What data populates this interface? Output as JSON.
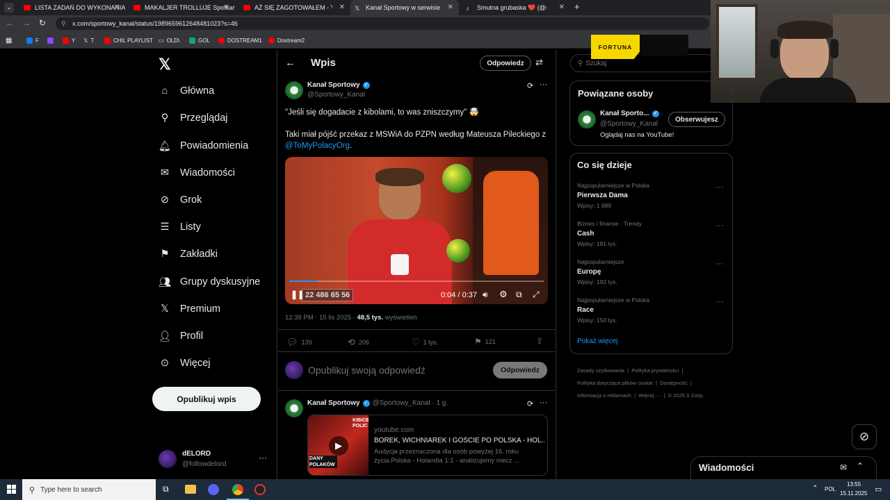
{
  "browser": {
    "tabs": [
      {
        "label": "LISTA ZADAŃ DO WYKONANIA"
      },
      {
        "label": "MAKALJER TROLLUJE Spotkani"
      },
      {
        "label": "AŻ SIĘ ZAGOTOWAŁEM - YouTu"
      },
      {
        "label": "Kanał Sportowy w serwisie X"
      },
      {
        "label": "Smutna grubaska ❤️ (@sm"
      }
    ],
    "url": "x.com/sportowy_kanal/status/1989659612648481023?s=46",
    "bookmarks": [
      "F",
      "Y",
      "T",
      "CHIL PLAYLIST",
      "OLD\\",
      "GOL",
      "DOSTREAM1",
      "Dostream2"
    ]
  },
  "sidebar": {
    "items": [
      {
        "label": "Główna"
      },
      {
        "label": "Przeglądaj"
      },
      {
        "label": "Powiadomienia"
      },
      {
        "label": "Wiadomości"
      },
      {
        "label": "Grok"
      },
      {
        "label": "Listy"
      },
      {
        "label": "Zakładki"
      },
      {
        "label": "Grupy dyskusyjne"
      },
      {
        "label": "Premium"
      },
      {
        "label": "Profil"
      },
      {
        "label": "Więcej"
      }
    ],
    "post_button": "Opublikuj wpis",
    "account": {
      "name": "dELORD",
      "handle": "@followdelord"
    }
  },
  "main": {
    "header_title": "Wpis",
    "reply_button": "Odpowiedz",
    "tweet": {
      "author": "Kanał Sportowy",
      "handle": "@Sportowy_Kanal",
      "quote_line": "\"Jeśli się dogadacie z kibolami, to was zniszczymy\" 🤯",
      "body": "Taki miał pójść przekaz z MSWiA do PZPN według Mateusza Pileckiego z",
      "mention": "@ToMyPolacyOrg",
      "mention_tail": ".",
      "video": {
        "time": "0:04 / 0:37",
        "overlay_number": "22 486 65 56",
        "progress": 0.11
      },
      "timestamp": "12:39 PM · 15 lis 2025 · ",
      "views_count": "48,5 tys.",
      "views_label": " wyświetleń",
      "stats": {
        "replies": "139",
        "reposts": "206",
        "likes": "1 tys.",
        "bookmarks": "121"
      }
    },
    "compose": {
      "placeholder": "Opublikuj swoją odpowiedź",
      "button": "Odpowiedz"
    },
    "reply_tweet": {
      "author": "Kanał Sportowy",
      "handle_time": "@Sportowy_Kanal · 1 g.",
      "card_domain": "youtube.com",
      "card_title": "BOREK, WICHNIAREK I GOŚCIE PO POLSKA - HOL...",
      "card_desc": "Audycja przeznaczona dla osób powyżej 16. roku życia.Polska - Holandia 1:1 - analizujemy mecz ...",
      "thumb_text_top": "KIBICE POLIC",
      "thumb_text_bottom": "DANY POLAKÓW"
    }
  },
  "right": {
    "search_placeholder": "Szukaj",
    "ad_text": "FORTUNA",
    "related_title": "Powiązane osoby",
    "related": {
      "name": "Kanał Sporto...",
      "handle": "@Sportowy_Kanal",
      "bio": "Oglądaj nas na YouTube!",
      "follow_label": "Obserwujesz"
    },
    "trending_title": "Co się dzieje",
    "trends": [
      {
        "category": "Najpopularniejsze w Polska",
        "name": "Pierwsza Dama",
        "count": "Wpisy: 1 689"
      },
      {
        "category": "Biznes i finanse · Trendy",
        "name": "Cash",
        "count": "Wpisy: 181 tys."
      },
      {
        "category": "Najpopularniejsze",
        "name": "Europę",
        "count": "Wpisy: 192 tys."
      },
      {
        "category": "Najpopularniejsze w Polska",
        "name": "Race",
        "count": "Wpisy: 150 tys."
      }
    ],
    "show_more": "Pokaż więcej",
    "footer": [
      "Zasady użytkowania",
      "Polityka prywatności",
      "Polityka dotycząca plików cookie",
      "Dostępność",
      "Informacja o reklamach",
      "Więcej ···",
      "© 2025 X Corp."
    ],
    "messages_title": "Wiadomości"
  },
  "taskbar": {
    "search_placeholder": "Type here to search",
    "lang": "POL",
    "time": "13:55",
    "date": "15.11.2025"
  },
  "colors": {
    "accent": "#1d9bf0",
    "bg": "#000000",
    "border": "#2f3336",
    "muted": "#71767b"
  }
}
